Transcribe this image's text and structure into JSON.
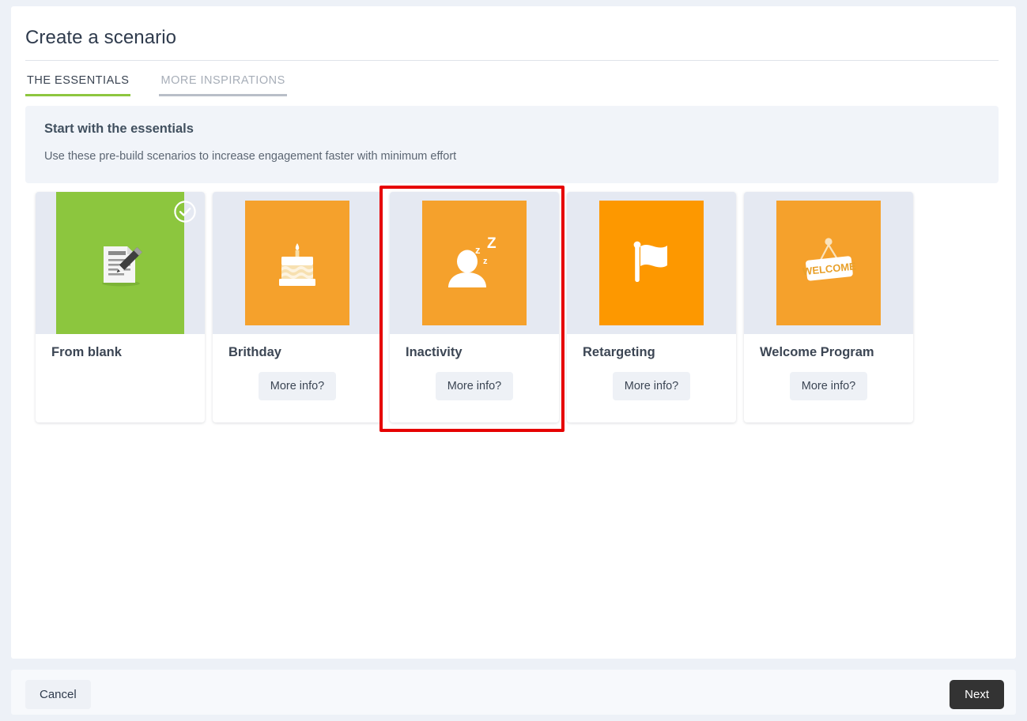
{
  "page": {
    "title": "Create a scenario"
  },
  "tabs": [
    {
      "label": "THE ESSENTIALS",
      "active": true
    },
    {
      "label": "MORE INSPIRATIONS",
      "active": false
    }
  ],
  "banner": {
    "title": "Start with the essentials",
    "subtitle": "Use these pre-build scenarios to increase engagement faster with minimum effort"
  },
  "cards": [
    {
      "title": "From blank",
      "icon": "document-pencil-icon",
      "tile_color": "#8cc63e",
      "selected": true,
      "full_bleed": true,
      "has_more_info": false,
      "more_info_label": ""
    },
    {
      "title": "Brithday",
      "icon": "birthday-cake-icon",
      "tile_color": "#f5a12c",
      "selected": false,
      "full_bleed": false,
      "has_more_info": true,
      "more_info_label": "More info?"
    },
    {
      "title": "Inactivity",
      "icon": "sleeping-person-icon",
      "tile_color": "#f5a12c",
      "selected": false,
      "full_bleed": false,
      "has_more_info": true,
      "more_info_label": "More info?",
      "highlighted": true
    },
    {
      "title": "Retargeting",
      "icon": "flag-icon",
      "tile_color": "#fd9800",
      "selected": false,
      "full_bleed": false,
      "has_more_info": true,
      "more_info_label": "More info?"
    },
    {
      "title": "Welcome Program",
      "icon": "welcome-sign-icon",
      "tile_color": "#f5a12c",
      "selected": false,
      "full_bleed": false,
      "has_more_info": true,
      "more_info_label": "More info?",
      "sign_text": "WELCOME"
    }
  ],
  "footer": {
    "cancel_label": "Cancel",
    "next_label": "Next"
  },
  "colors": {
    "accent_green": "#8cc63e",
    "accent_orange": "#f5a12c",
    "highlight_red": "#e60000",
    "next_button": "#333333"
  }
}
